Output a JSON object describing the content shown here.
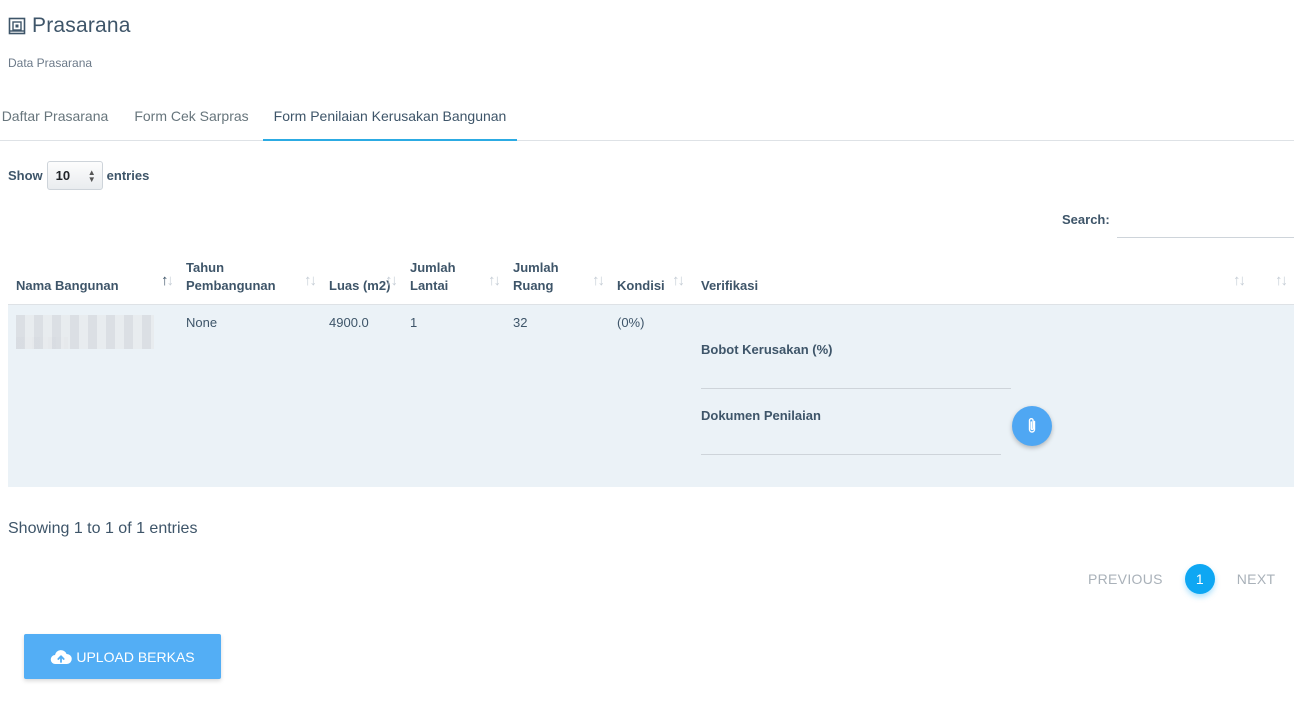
{
  "header": {
    "title": "Prasarana",
    "subtitle": "Data Prasarana",
    "icon": "building-icon"
  },
  "tabs": [
    {
      "label": "Daftar Prasarana"
    },
    {
      "label": "Form Cek Sarpras"
    },
    {
      "label": "Form Penilaian Kerusakan Bangunan",
      "active": true
    }
  ],
  "length_control": {
    "prefix": "Show",
    "value": "10",
    "suffix": "entries"
  },
  "search": {
    "label": "Search:",
    "value": ""
  },
  "table": {
    "columns": [
      "Nama Bangunan",
      "Tahun Pembangunan",
      "Luas (m2)",
      "Jumlah Lantai",
      "Jumlah Ruang",
      "Kondisi",
      "Verifikasi"
    ],
    "rows": [
      {
        "nama": "",
        "tahun": "None",
        "luas": "4900.0",
        "lantai": "1",
        "ruang": "32",
        "kondisi": "(0%)",
        "verifikasi": {
          "bobot_label": "Bobot Kerusakan (%)",
          "bobot_value": "",
          "dokumen_label": "Dokumen Penilaian",
          "dokumen_value": ""
        }
      }
    ]
  },
  "info": "Showing 1 to 1 of 1 entries",
  "pagination": {
    "previous": "PREVIOUS",
    "current": "1",
    "next": "NEXT"
  },
  "upload": {
    "label": "UPLOAD BERKAS",
    "icon": "cloud-upload-icon"
  },
  "colors": {
    "accent": "#0ea7f3",
    "button": "#53aef5",
    "row_bg": "#ebf2f7",
    "text": "#3e5569"
  }
}
